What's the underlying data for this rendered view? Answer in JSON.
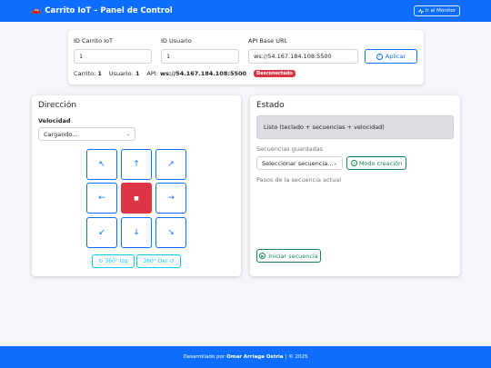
{
  "header": {
    "car_icon": "🚗",
    "title": "Carrito IoT – Panel de Control",
    "monitor_icon": "activity-icon",
    "monitor_label": "Ir al Monitor"
  },
  "config": {
    "car_id_label": "ID Carrito IoT",
    "car_id_value": "1",
    "user_id_label": "ID Usuario",
    "user_id_value": "1",
    "api_label": "API Base URL",
    "api_value": "ws://54.167.184.108:5500",
    "apply_label": "Aplicar",
    "status": {
      "car_prefix": "Carrito:",
      "car_value": "1",
      "user_prefix": "Usuario:",
      "user_value": "1",
      "api_prefix": "API:",
      "api_value": "ws://54.167.184.108:5500",
      "badge": "Desconectado"
    }
  },
  "direction": {
    "title": "Dirección",
    "speed_label": "Velocidad",
    "speed_value": "Cargando...",
    "arrows": {
      "up_left": "↖",
      "up": "↑",
      "up_right": "↗",
      "left": "←",
      "stop": "■",
      "right": "→",
      "down_left": "↙",
      "down": "↓",
      "down_right": "↘"
    },
    "rotate_left_icon": "↻",
    "rotate_left_label": "360° Izq",
    "rotate_right_label": "360° Der",
    "rotate_right_icon": "↺"
  },
  "state": {
    "title": "Estado",
    "status_text": "Listo (teclado + secuencias + velocidad)",
    "saved_label": "Secuencias guardadas",
    "select_value": "Seleccionar secuencia...",
    "mode_label": "Modo creación",
    "steps_label": "Pasos de la secuencia actual",
    "start_label": "Iniciar secuencia"
  },
  "footer": {
    "prefix": "Desarrollado por",
    "author": "Omar Arriaga Ostria",
    "suffix": "| © 2025"
  },
  "colors": {
    "primary": "#0d6efd",
    "danger": "#dc3545",
    "success": "#198754",
    "info": "#0dcaf0"
  }
}
